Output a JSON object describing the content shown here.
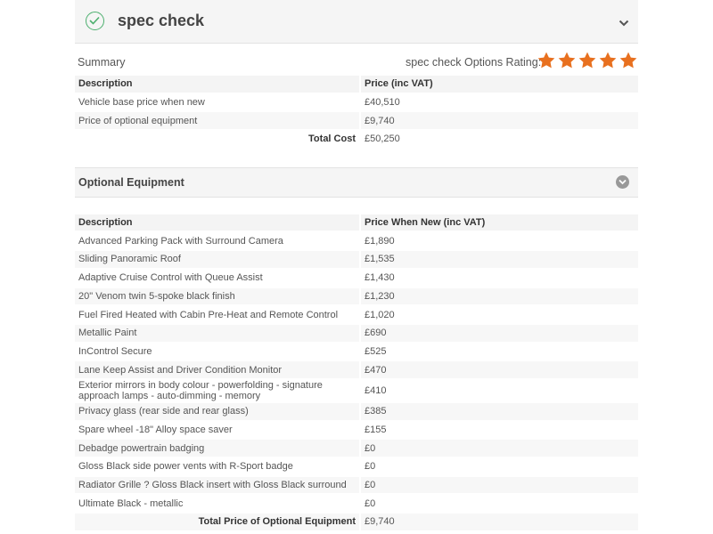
{
  "header": {
    "title": "spec check"
  },
  "summary": {
    "label": "Summary",
    "rating_label": "spec check Options Rating:",
    "rating_value": 5,
    "rating_max": 5,
    "star_color": "#e8701f",
    "columns": [
      "Description",
      "Price (inc VAT)"
    ],
    "rows": [
      {
        "desc": "Vehicle base price when new",
        "price": "£40,510"
      },
      {
        "desc": "Price of optional equipment",
        "price": "£9,740"
      }
    ],
    "total_label": "Total Cost",
    "total_value": "£50,250"
  },
  "optional": {
    "title": "Optional Equipment",
    "columns": [
      "Description",
      "Price When New (inc VAT)"
    ],
    "rows": [
      {
        "desc": "Advanced Parking Pack with Surround Camera",
        "price": "£1,890"
      },
      {
        "desc": "Sliding Panoramic Roof",
        "price": "£1,535"
      },
      {
        "desc": "Adaptive Cruise Control with Queue Assist",
        "price": "£1,430"
      },
      {
        "desc": "20\" Venom twin 5-spoke black finish",
        "price": "£1,230"
      },
      {
        "desc": "Fuel Fired Heated with Cabin Pre-Heat and Remote Control",
        "price": "£1,020"
      },
      {
        "desc": "Metallic Paint",
        "price": "£690"
      },
      {
        "desc": "InControl Secure",
        "price": "£525"
      },
      {
        "desc": "Lane Keep Assist and Driver Condition Monitor",
        "price": "£470"
      },
      {
        "desc": "Exterior mirrors in body colour - powerfolding - signature approach lamps - auto-dimming - memory",
        "price": "£410"
      },
      {
        "desc": "Privacy glass (rear side and rear glass)",
        "price": "£385"
      },
      {
        "desc": "Spare wheel -18\" Alloy space saver",
        "price": "£155"
      },
      {
        "desc": "Debadge powertrain badging",
        "price": "£0"
      },
      {
        "desc": "Gloss Black side power vents with R-Sport badge",
        "price": "£0"
      },
      {
        "desc": "Radiator Grille ? Gloss Black insert with Gloss Black surround",
        "price": "£0"
      },
      {
        "desc": "Ultimate Black - metallic",
        "price": "£0"
      }
    ],
    "total_label": "Total Price of Optional Equipment",
    "total_value": "£9,740"
  }
}
